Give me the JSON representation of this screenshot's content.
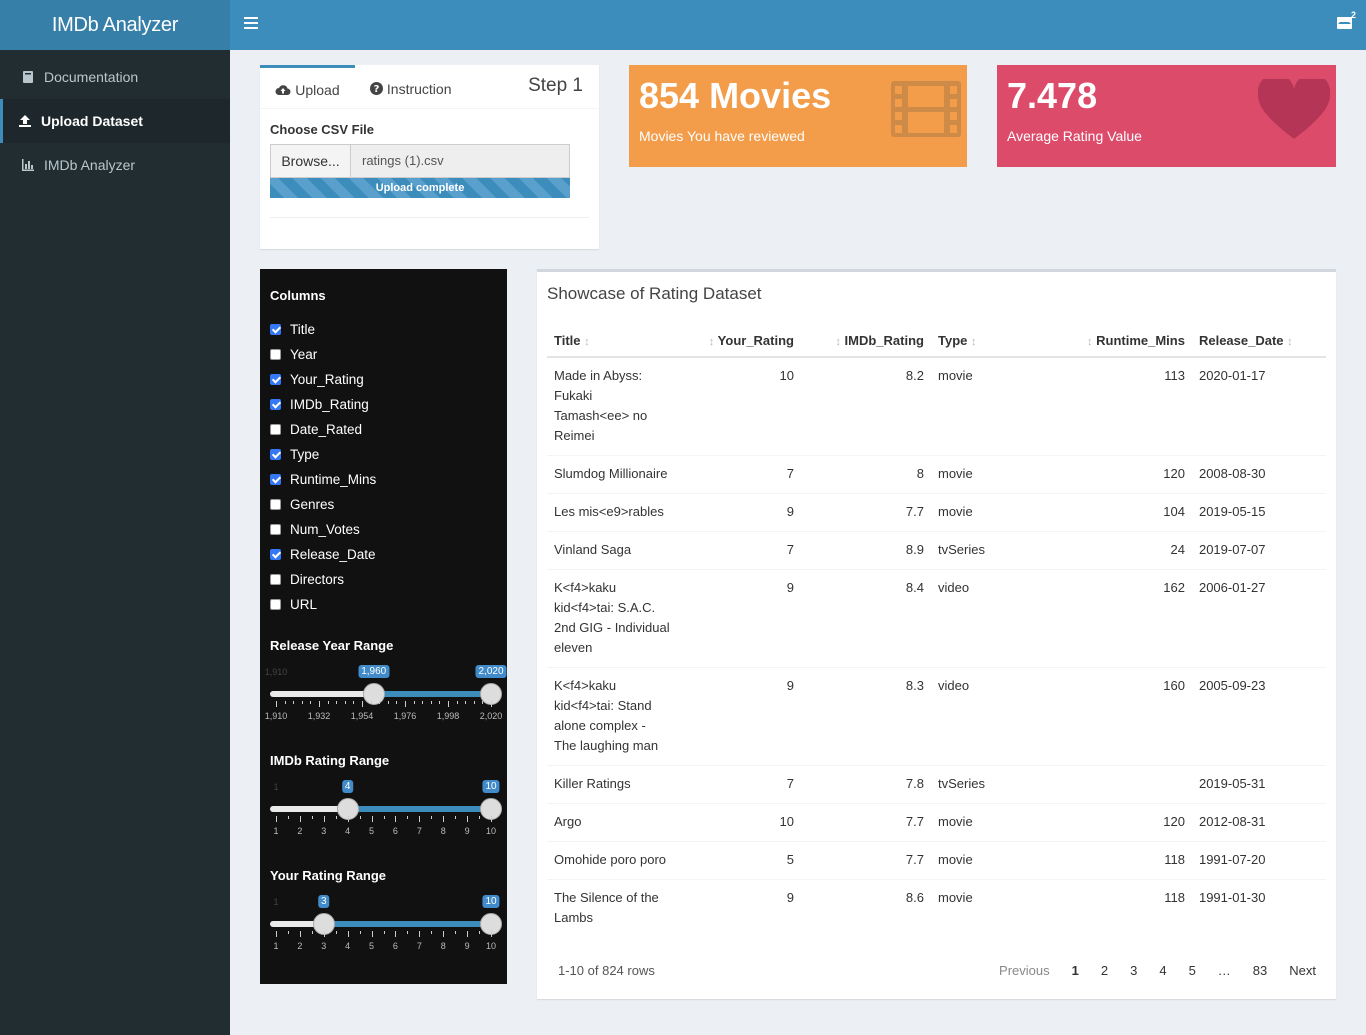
{
  "app": {
    "title": "IMDb Analyzer",
    "mail_badge": "2"
  },
  "sidebar": {
    "items": [
      {
        "label": "Documentation",
        "icon": "book-icon",
        "active": false
      },
      {
        "label": "Upload Dataset",
        "icon": "upload-icon",
        "active": true
      },
      {
        "label": "IMDb Analyzer",
        "icon": "bar-chart-icon",
        "active": false
      }
    ]
  },
  "upload": {
    "tabs": [
      {
        "label": "Upload",
        "icon": "cloud-upload-icon"
      },
      {
        "label": "Instruction",
        "icon": "question-circle-icon"
      }
    ],
    "step": "Step 1",
    "csv_label": "Choose CSV File",
    "browse_label": "Browse...",
    "filename": "ratings (1).csv",
    "progress_text": "Upload complete",
    "progress": 1.0
  },
  "info": {
    "movies": {
      "value": "854 Movies",
      "subtitle": "Movies You have reviewed",
      "icon": "film-icon",
      "color": "#f39c4a"
    },
    "rating": {
      "value": "7.478",
      "subtitle": "Average Rating Value",
      "icon": "heart-icon",
      "color": "#dd4b6b"
    }
  },
  "filters": {
    "columns_title": "Columns",
    "columns": [
      {
        "label": "Title",
        "checked": true
      },
      {
        "label": "Year",
        "checked": false
      },
      {
        "label": "Your_Rating",
        "checked": true
      },
      {
        "label": "IMDb_Rating",
        "checked": true
      },
      {
        "label": "Date_Rated",
        "checked": false
      },
      {
        "label": "Type",
        "checked": true
      },
      {
        "label": "Runtime_Mins",
        "checked": true
      },
      {
        "label": "Genres",
        "checked": false
      },
      {
        "label": "Num_Votes",
        "checked": false
      },
      {
        "label": "Release_Date",
        "checked": true
      },
      {
        "label": "Directors",
        "checked": false
      },
      {
        "label": "URL",
        "checked": false
      }
    ],
    "sliders": [
      {
        "title": "Release Year Range",
        "min": 1910,
        "max": 2020,
        "from": 1960,
        "to": 2020,
        "min_label": "1,910",
        "from_label": "1,960",
        "to_label": "2,020",
        "ticks": [
          "1,910",
          "1,932",
          "1,954",
          "1,976",
          "1,998",
          "2,020"
        ]
      },
      {
        "title": "IMDb Rating Range",
        "min": 1,
        "max": 10,
        "from": 4,
        "to": 10,
        "min_label": "1",
        "from_label": "4",
        "to_label": "10",
        "ticks": [
          "1",
          "2",
          "3",
          "4",
          "5",
          "6",
          "7",
          "8",
          "9",
          "10"
        ]
      },
      {
        "title": "Your Rating Range",
        "min": 1,
        "max": 10,
        "from": 3,
        "to": 10,
        "min_label": "1",
        "from_label": "3",
        "to_label": "10",
        "ticks": [
          "1",
          "2",
          "3",
          "4",
          "5",
          "6",
          "7",
          "8",
          "9",
          "10"
        ]
      }
    ]
  },
  "table": {
    "title": "Showcase of Rating Dataset",
    "headers": [
      "Title",
      "Your_Rating",
      "IMDb_Rating",
      "Type",
      "Runtime_Mins",
      "Release_Date"
    ],
    "rows": [
      [
        "Made in Abyss: Fukaki Tamash<ee> no Reimei",
        "10",
        "8.2",
        "movie",
        "113",
        "2020-01-17"
      ],
      [
        "Slumdog Millionaire",
        "7",
        "8",
        "movie",
        "120",
        "2008-08-30"
      ],
      [
        "Les mis<e9>rables",
        "9",
        "7.7",
        "movie",
        "104",
        "2019-05-15"
      ],
      [
        "Vinland Saga",
        "7",
        "8.9",
        "tvSeries",
        "24",
        "2019-07-07"
      ],
      [
        "K<f4>kaku kid<f4>tai: S.A.C. 2nd GIG - Individual eleven",
        "9",
        "8.4",
        "video",
        "162",
        "2006-01-27"
      ],
      [
        "K<f4>kaku kid<f4>tai: Stand alone complex - The laughing man",
        "9",
        "8.3",
        "video",
        "160",
        "2005-09-23"
      ],
      [
        "Killer Ratings",
        "7",
        "7.8",
        "tvSeries",
        "",
        "2019-05-31"
      ],
      [
        "Argo",
        "10",
        "7.7",
        "movie",
        "120",
        "2012-08-31"
      ],
      [
        "Omohide poro poro",
        "5",
        "7.7",
        "movie",
        "118",
        "1991-07-20"
      ],
      [
        "The Silence of the Lambs",
        "9",
        "8.6",
        "movie",
        "118",
        "1991-01-30"
      ]
    ],
    "info": "1-10 of 824 rows",
    "pager": {
      "previous": "Previous",
      "pages": [
        "1",
        "2",
        "3",
        "4",
        "5",
        "…",
        "83"
      ],
      "current": "1",
      "next": "Next"
    }
  }
}
